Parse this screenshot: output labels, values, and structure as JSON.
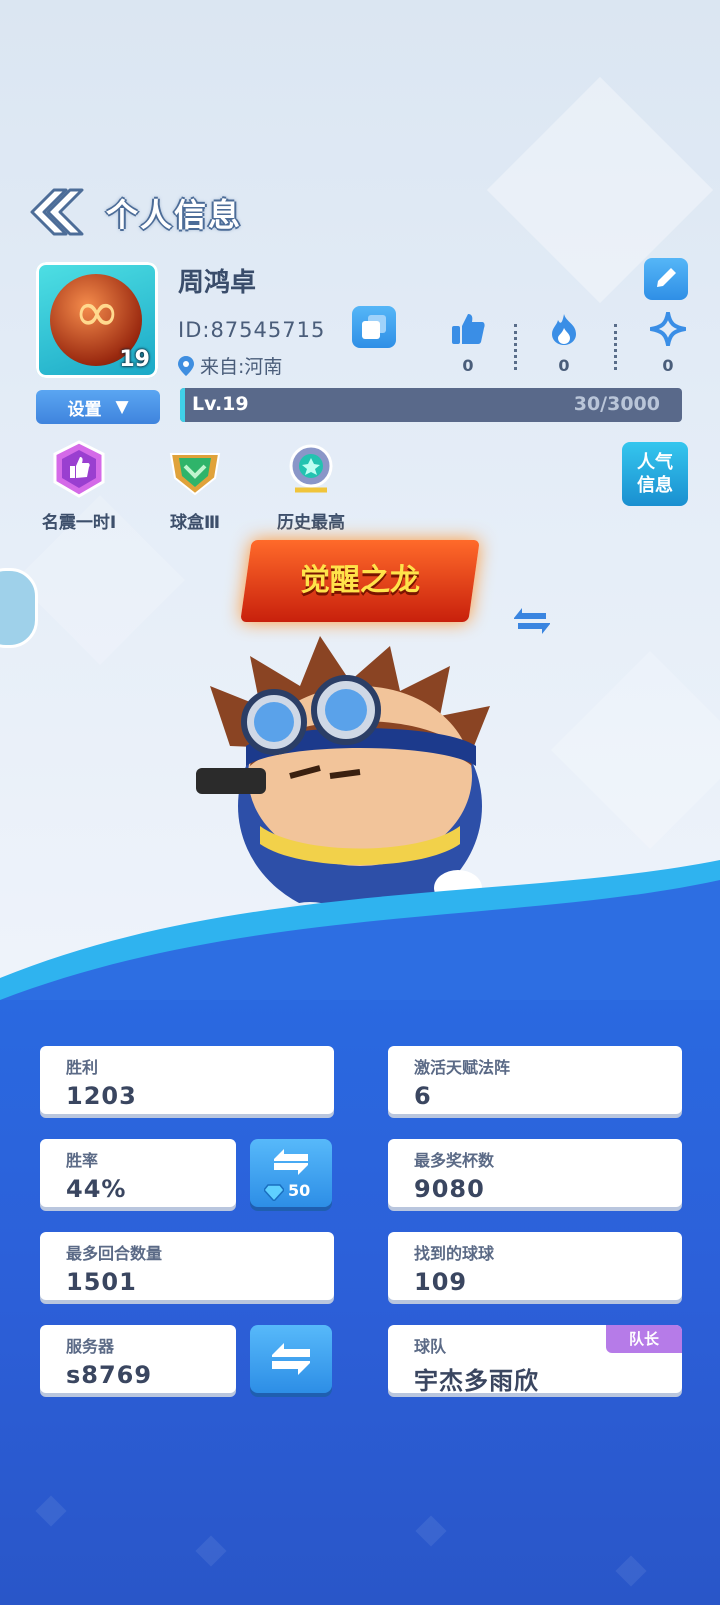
{
  "header": {
    "title": "个人信息"
  },
  "profile": {
    "name": "周鸿卓",
    "id_text": "ID:87545715",
    "location": "来自:河南",
    "avatar_level": "19",
    "settings_label": "设置",
    "likes": "0",
    "hot": "0",
    "stars": "0"
  },
  "level": {
    "label": "Lv.19",
    "xp_text": "30/3000",
    "progress": 0.01
  },
  "badges": [
    {
      "label": "名震一时Ⅰ",
      "icon": "thumbs-up-medal-icon"
    },
    {
      "label": "球盒Ⅲ",
      "icon": "green-shield-icon"
    },
    {
      "label": "历史最高",
      "icon": "star-gem-icon"
    }
  ],
  "popular_label": "人气信息",
  "popular_lines": [
    "人气",
    "信息"
  ],
  "title_banner": "觉醒之龙",
  "stats": {
    "wins": {
      "label": "胜利",
      "value": "1203"
    },
    "talent": {
      "label": "激活天赋法阵",
      "value": "6"
    },
    "winrate": {
      "label": "胜率",
      "value": "44%"
    },
    "trophies": {
      "label": "最多奖杯数",
      "value": "9080"
    },
    "rounds": {
      "label": "最多回合数量",
      "value": "1501"
    },
    "balls": {
      "label": "找到的球球",
      "value": "109"
    },
    "server": {
      "label": "服务器",
      "value": "s8769"
    },
    "team": {
      "label": "球队",
      "value": "宇杰多雨欣",
      "role": "队长"
    }
  },
  "winrate_swap_cost": "50",
  "colors": {
    "accent": "#2f8fe6",
    "bottom_bg": "#2a69e0",
    "captain": "#b67be8",
    "levelbar": "#59698a",
    "levelfill": "#40d0e8"
  }
}
